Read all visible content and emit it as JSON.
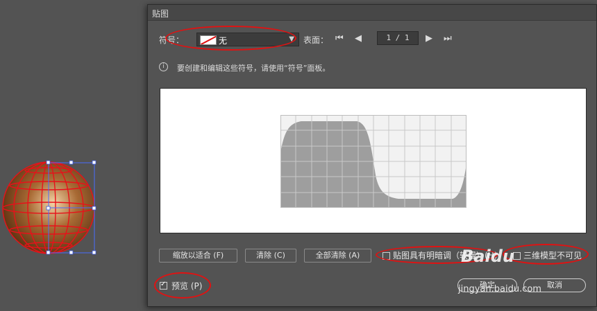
{
  "dialog": {
    "title": "贴图",
    "symbol_label": "符号：",
    "symbol_value": "无",
    "surface_label": "表面：",
    "page_field": "1 / 1",
    "info_text": "要创建和编辑这些符号，请使用“符号”面板。",
    "buttons": {
      "fit": "缩放以适合 (F)",
      "clear": "清除 (C)",
      "clear_all": "全部清除 (A)",
      "ok": "确定",
      "cancel": "取消"
    },
    "checkboxes": {
      "shade_artwork": {
        "label": "贴图具有明暗调（较慢）(H)",
        "checked": false
      },
      "invisible_geometry": {
        "label": "三维模型不可见",
        "checked": false
      },
      "preview": {
        "label": "预览 (P)",
        "checked": true
      }
    },
    "icons": {
      "info": "info-icon",
      "first": "first-page-icon",
      "prev": "prev-page-icon",
      "next": "next-page-icon",
      "last": "last-page-icon",
      "dropdown": "chevron-down-icon"
    }
  },
  "watermark": {
    "brand": "Baidu",
    "site": "jingyan.baidu.com"
  },
  "colors": {
    "annotation": "#e01212",
    "dialog_bg": "#535353",
    "preview_bg": "#ffffff"
  }
}
